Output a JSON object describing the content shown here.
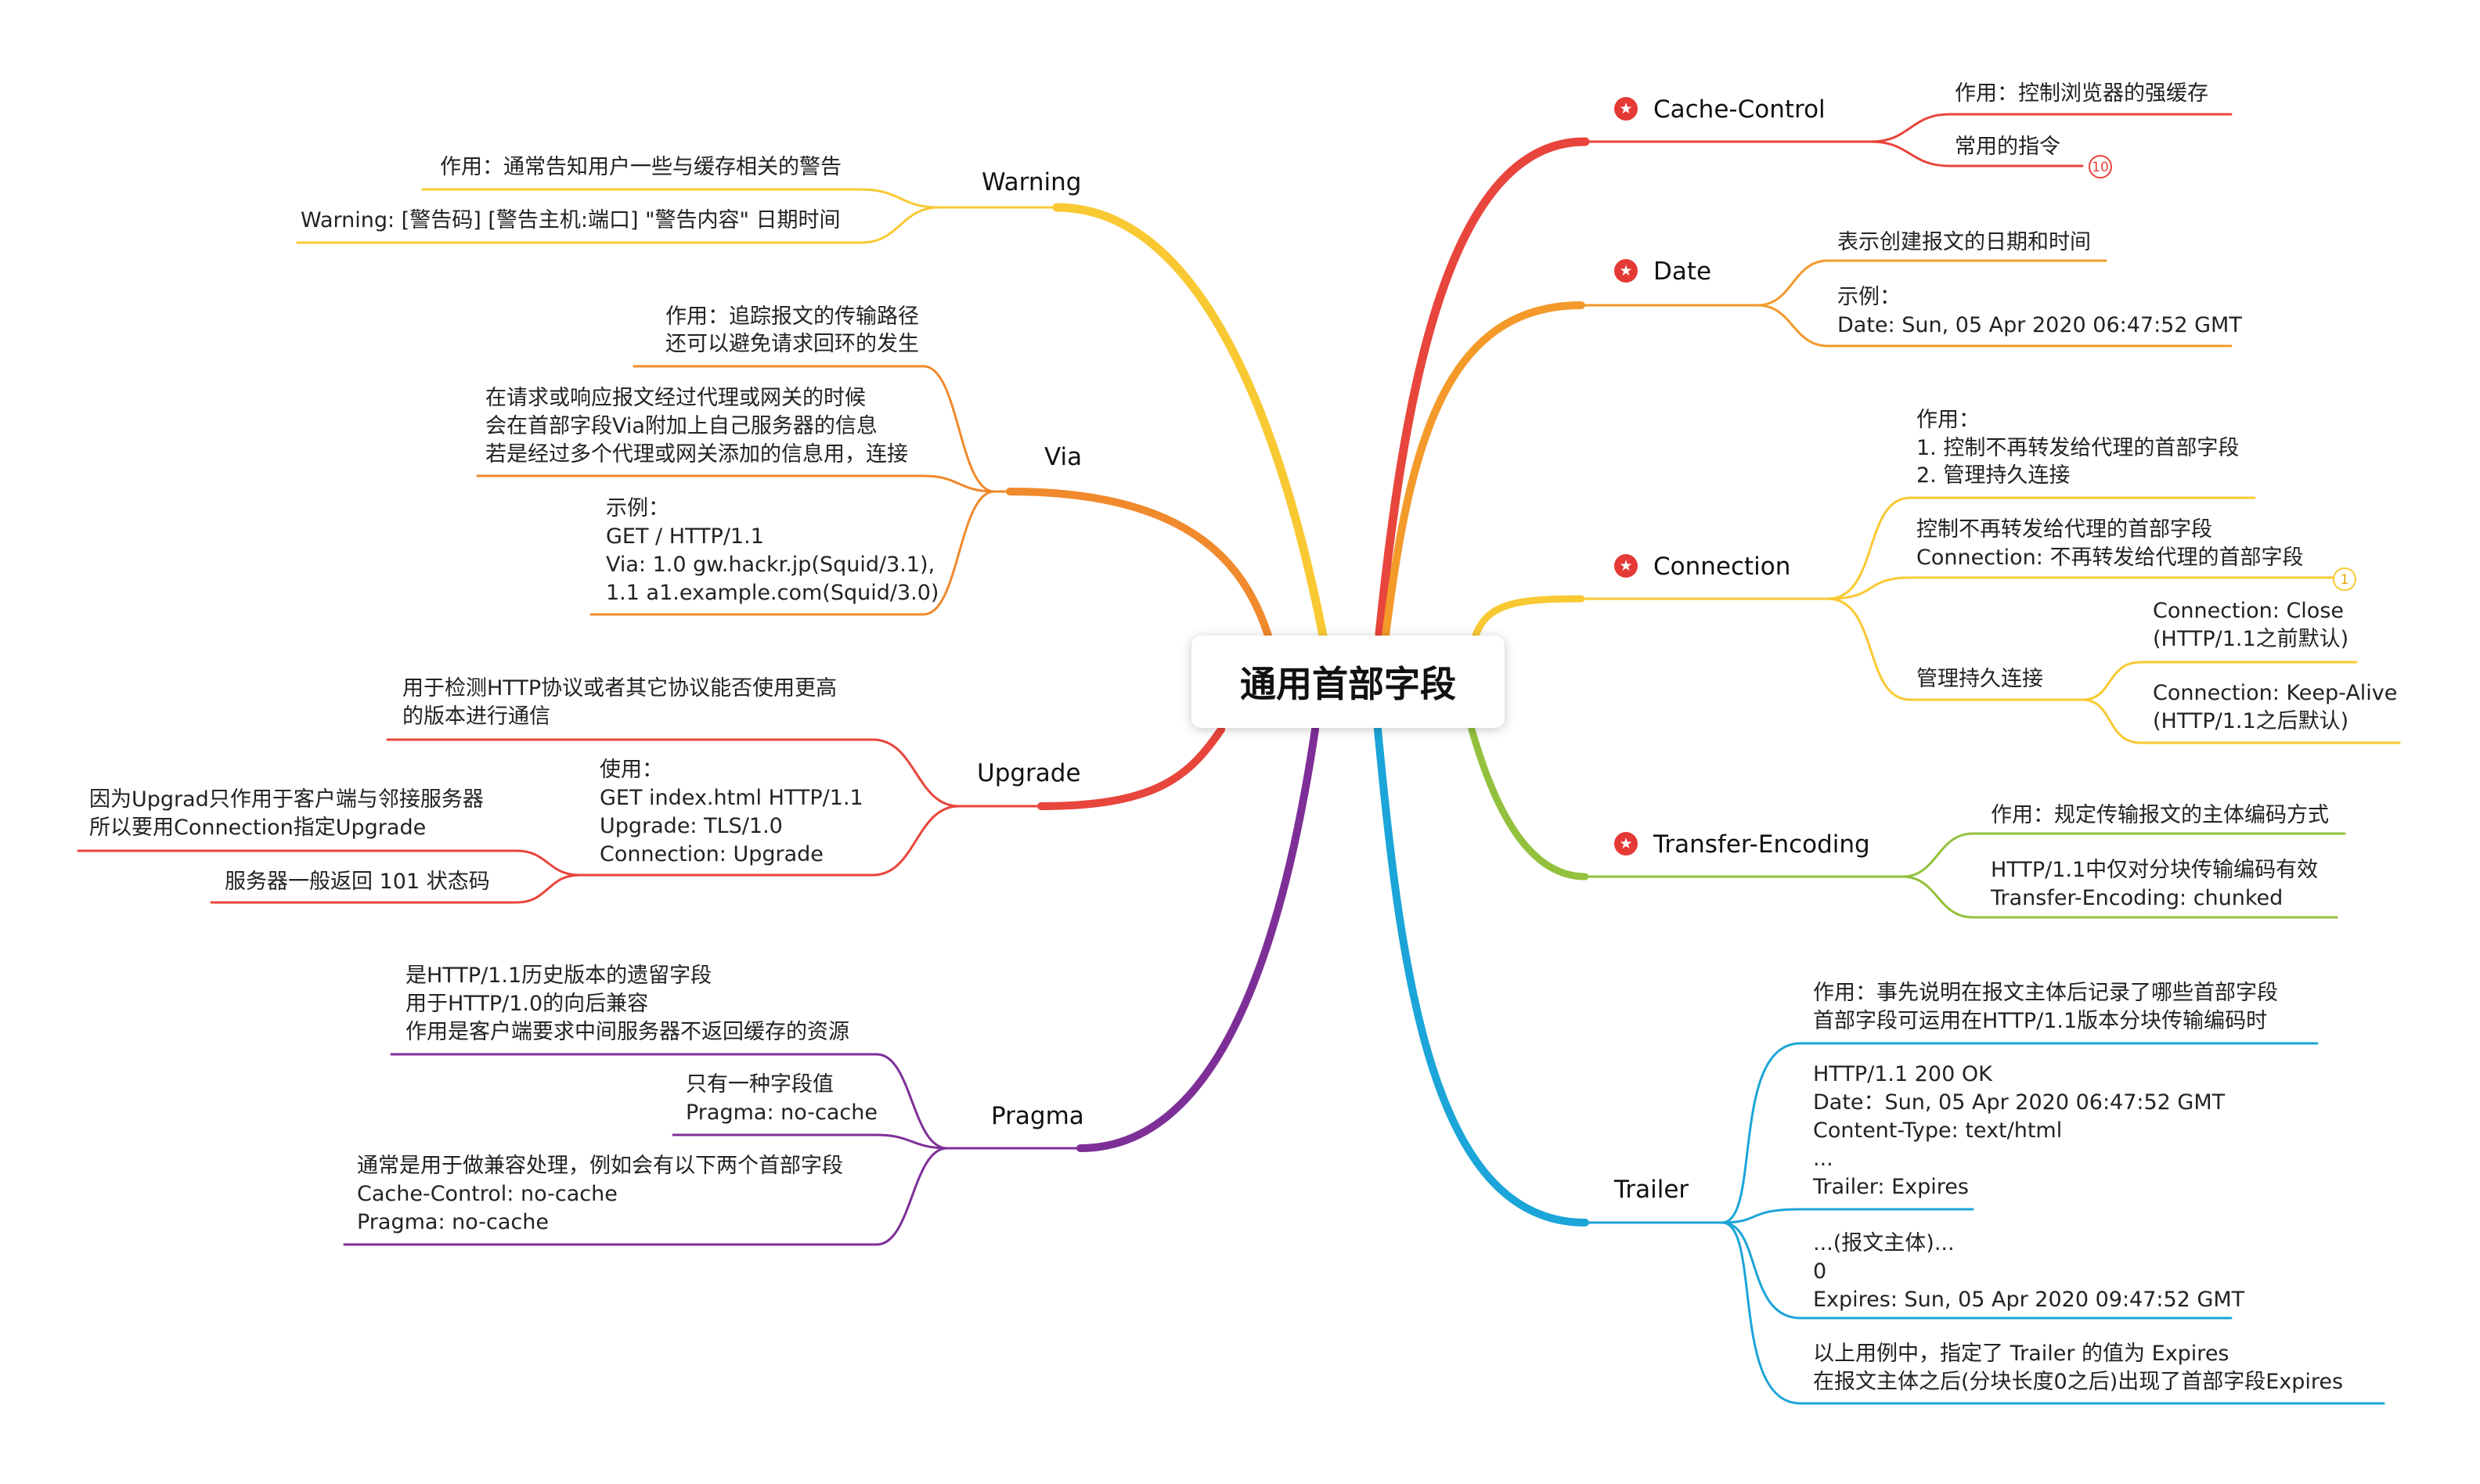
{
  "central": "通用首部字段",
  "colors": {
    "cache_control": "#e8453c",
    "date": "#f39a2b",
    "connection": "#f9c933",
    "transfer_encoding": "#93c13d",
    "trailer": "#1ba5d8",
    "warning": "#f9c933",
    "via": "#f08a2c",
    "upgrade": "#e8453c",
    "pragma": "#7e2f97",
    "star": "#e53935"
  },
  "branches": {
    "cache_control": {
      "title": "Cache-Control",
      "icon": "star-icon",
      "items": [
        "作用：控制浏览器的强缓存",
        "常用的指令"
      ],
      "count_badge": "10"
    },
    "date": {
      "title": "Date",
      "icon": "star-icon",
      "items": [
        "表示创建报文的日期和时间",
        "示例：",
        "Date: Sun, 05 Apr 2020 06:47:52 GMT"
      ]
    },
    "connection": {
      "title": "Connection",
      "icon": "star-icon",
      "items": [
        "作用：",
        "1. 控制不再转发给代理的首部字段",
        "2. 管理持久连接",
        "控制不再转发给代理的首部字段",
        "Connection: 不再转发给代理的首部字段",
        "管理持久连接",
        "Connection: Close",
        "(HTTP/1.1之前默认)",
        "Connection: Keep-Alive",
        "(HTTP/1.1之后默认)"
      ],
      "count_badge": "1"
    },
    "transfer_encoding": {
      "title": "Transfer-Encoding",
      "icon": "star-icon",
      "items": [
        "作用：规定传输报文的主体编码方式",
        "HTTP/1.1中仅对分块传输编码有效",
        "Transfer-Encoding: chunked"
      ]
    },
    "trailer": {
      "title": "Trailer",
      "items": [
        "作用：事先说明在报文主体后记录了哪些首部字段",
        "首部字段可运用在HTTP/1.1版本分块传输编码时",
        "HTTP/1.1 200 OK",
        "Date：Sun, 05 Apr 2020 06:47:52 GMT",
        "Content-Type: text/html",
        "...",
        "Trailer: Expires",
        "...(报文主体)...",
        "0",
        "Expires: Sun, 05 Apr 2020 09:47:52 GMT",
        "以上用例中，指定了 Trailer 的值为 Expires",
        "在报文主体之后(分块长度0之后)出现了首部字段Expires"
      ]
    },
    "warning": {
      "title": "Warning",
      "items": [
        "作用：通常告知用户一些与缓存相关的警告",
        "Warning: [警告码] [警告主机:端口] \"警告内容\" 日期时间"
      ]
    },
    "via": {
      "title": "Via",
      "items": [
        "作用：追踪报文的传输路径",
        "还可以避免请求回环的发生",
        "在请求或响应报文经过代理或网关的时候",
        "会在首部字段Via附加上自己服务器的信息",
        "若是经过多个代理或网关添加的信息用，连接",
        "示例：",
        "GET / HTTP/1.1",
        "Via: 1.0 gw.hackr.jp(Squid/3.1),",
        "1.1 a1.example.com(Squid/3.0)"
      ]
    },
    "upgrade": {
      "title": "Upgrade",
      "items": [
        "用于检测HTTP协议或者其它协议能否使用更高",
        "的版本进行通信",
        "使用：",
        "GET index.html HTTP/1.1",
        "Upgrade: TLS/1.0",
        "Connection: Upgrade",
        "因为Upgrad只作用于客户端与邻接服务器",
        "所以要用Connection指定Upgrade",
        "服务器一般返回 101 状态码"
      ]
    },
    "pragma": {
      "title": "Pragma",
      "items": [
        "是HTTP/1.1历史版本的遗留字段",
        "用于HTTP/1.0的向后兼容",
        "作用是客户端要求中间服务器不返回缓存的资源",
        "只有一种字段值",
        "Pragma: no-cache",
        "通常是用于做兼容处理，例如会有以下两个首部字段",
        "Cache-Control: no-cache",
        "Pragma: no-cache"
      ]
    }
  }
}
